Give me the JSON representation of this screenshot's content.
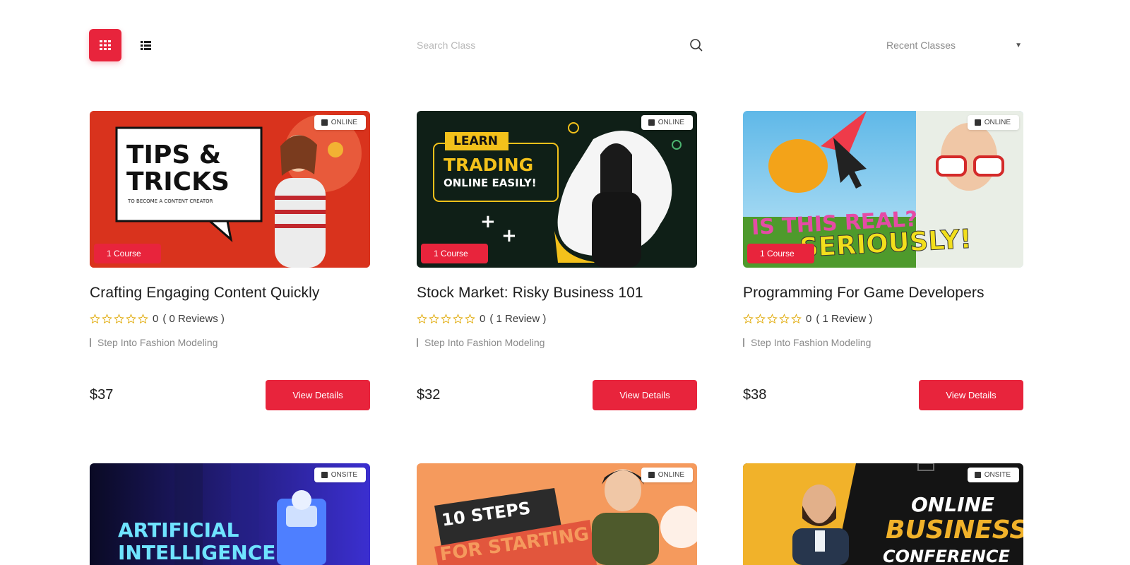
{
  "toolbar": {
    "search_placeholder": "Search Class",
    "sort_value": "Recent Classes",
    "colors": {
      "accent": "#e8243c"
    }
  },
  "courses": [
    {
      "title": "Crafting Engaging Content Quickly",
      "mode": "ONLINE",
      "count": "1 Course",
      "rating": "0",
      "reviews": "( 0 Reviews )",
      "category": "Step Into Fashion Modeling",
      "price": "$37",
      "button": "View Details",
      "art": {
        "line1": "TIPS &",
        "line2": "TRICKS",
        "sub": "TO BECOME A CONTENT CREATOR"
      }
    },
    {
      "title": "Stock Market: Risky Business 101",
      "mode": "ONLINE",
      "count": "1 Course",
      "rating": "0",
      "reviews": "( 1 Review )",
      "category": "Step Into Fashion Modeling",
      "price": "$32",
      "button": "View Details",
      "art": {
        "line1": "LEARN",
        "line2": "TRADING",
        "line3": "ONLINE EASILY!"
      }
    },
    {
      "title": "Programming For Game Developers",
      "mode": "ONLINE",
      "count": "1 Course",
      "rating": "0",
      "reviews": "( 1 Review )",
      "category": "Step Into Fashion Modeling",
      "price": "$38",
      "button": "View Details",
      "art": {
        "line1": "IS THIS REAL?",
        "line2": "SERIOUSLY!"
      }
    },
    {
      "mode": "ONSITE",
      "art": {
        "line1": "ARTIFICIAL",
        "line2": "INTELLIGENCE"
      }
    },
    {
      "mode": "ONLINE",
      "art": {
        "line1": "10 STEPS",
        "line2": "FOR STARTING"
      }
    },
    {
      "mode": "ONSITE",
      "art": {
        "line1": "ONLINE",
        "line2": "BUSINESS",
        "line3": "CONFERENCE"
      }
    }
  ]
}
